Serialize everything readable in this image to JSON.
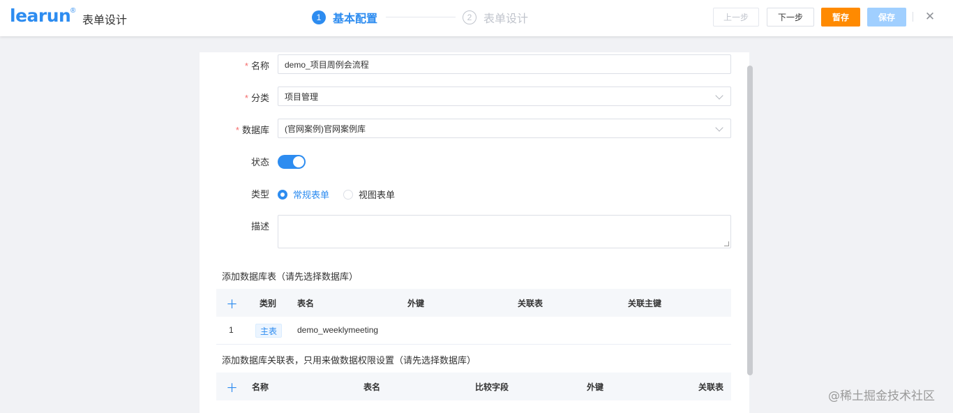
{
  "header": {
    "logo": "learun",
    "logo_mark": "®",
    "title": "表单设计",
    "steps": [
      {
        "num": "1",
        "label": "基本配置"
      },
      {
        "num": "2",
        "label": "表单设计"
      }
    ],
    "buttons": {
      "prev": "上一步",
      "next": "下一步",
      "draft": "暂存",
      "save": "保存"
    }
  },
  "form": {
    "name": {
      "label": "名称",
      "value": "demo_项目周例会流程"
    },
    "category": {
      "label": "分类",
      "value": "项目管理"
    },
    "database": {
      "label": "数据库",
      "value": "(官网案例)官网案例库"
    },
    "status": {
      "label": "状态",
      "on": true
    },
    "type": {
      "label": "类型",
      "options": [
        "常规表单",
        "视图表单"
      ],
      "selected": "常规表单"
    },
    "description": {
      "label": "描述",
      "value": ""
    }
  },
  "db_tables": {
    "title": "添加数据库表（请先选择数据库）",
    "columns": [
      "类别",
      "表名",
      "外键",
      "关联表",
      "关联主键"
    ],
    "rows": [
      {
        "index": "1",
        "category": "主表",
        "table": "demo_weeklymeeting"
      }
    ]
  },
  "rel_tables": {
    "title": "添加数据库关联表，只用来做数据权限设置（请先选择数据库）",
    "columns": [
      "名称",
      "表名",
      "比较字段",
      "外键",
      "关联表"
    ]
  },
  "watermark": "@稀土掘金技术社区",
  "colors": {
    "primary": "#2d8cf0",
    "draft": "#ff8a00",
    "save_disabled": "#a0cfff",
    "required": "#f56c6c"
  }
}
